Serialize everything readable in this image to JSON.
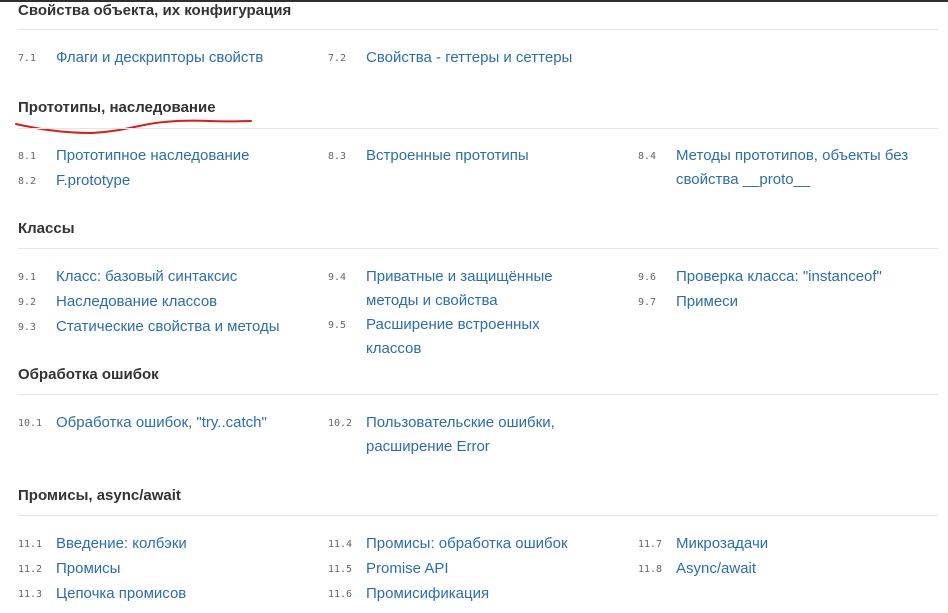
{
  "sections": [
    {
      "title": "Свойства объекта, их конфигурация",
      "items": [
        {
          "num": "7.1",
          "label": "Флаги и дескрипторы свойств"
        },
        {
          "num": "7.2",
          "label": "Свойства - геттеры и сеттеры"
        }
      ]
    },
    {
      "title": "Прототипы, наследование",
      "items": [
        {
          "num": "8.1",
          "label": "Прототипное наследование"
        },
        {
          "num": "8.2",
          "label": "F.prototype"
        },
        {
          "num": "8.3",
          "label": "Встроенные прототипы"
        },
        {
          "num": "8.4",
          "label": "Методы прототипов, объекты без свойства __proto__"
        }
      ]
    },
    {
      "title": "Классы",
      "items": [
        {
          "num": "9.1",
          "label": "Класс: базовый синтаксис"
        },
        {
          "num": "9.2",
          "label": "Наследование классов"
        },
        {
          "num": "9.3",
          "label": "Статические свойства и методы"
        },
        {
          "num": "9.4",
          "label": "Приватные и защищённые методы и свойства"
        },
        {
          "num": "9.5",
          "label": "Расширение встроенных классов"
        },
        {
          "num": "9.6",
          "label": "Проверка класса: \"instanceof\""
        },
        {
          "num": "9.7",
          "label": "Примеси"
        }
      ]
    },
    {
      "title": "Обработка ошибок",
      "items": [
        {
          "num": "10.1",
          "label": "Обработка ошибок, \"try..catch\""
        },
        {
          "num": "10.2",
          "label": "Пользовательские ошибки, расширение Error"
        }
      ]
    },
    {
      "title": "Промисы, async/await",
      "items": [
        {
          "num": "11.1",
          "label": "Введение: колбэки"
        },
        {
          "num": "11.2",
          "label": "Промисы"
        },
        {
          "num": "11.3",
          "label": "Цепочка промисов"
        },
        {
          "num": "11.4",
          "label": "Промисы: обработка ошибок"
        },
        {
          "num": "11.5",
          "label": "Promise API"
        },
        {
          "num": "11.6",
          "label": "Промисификация"
        },
        {
          "num": "11.7",
          "label": "Микрозадачи"
        },
        {
          "num": "11.8",
          "label": "Async/await"
        }
      ]
    }
  ],
  "annotation": {
    "color": "#e0191b"
  }
}
